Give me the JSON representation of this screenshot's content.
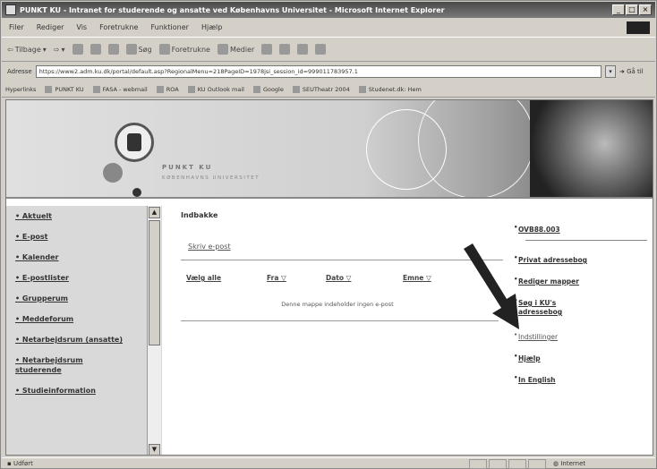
{
  "window": {
    "title": "PUNKT KU - Intranet for studerende og ansatte ved Københavns Universitet - Microsoft Internet Explorer",
    "controls": [
      "_",
      "□",
      "×"
    ]
  },
  "menubar": [
    "Filer",
    "Rediger",
    "Vis",
    "Foretrukne",
    "Funktioner",
    "Hjælp"
  ],
  "toolbar": {
    "back": "Tilbage",
    "search": "Søg",
    "favorites": "Foretrukne",
    "media": "Medier"
  },
  "address": {
    "label": "Adresse",
    "url": "https://www2.adm.ku.dk/portal/default.asp?RegionalMenu=218PageID=1978jsi_session_id=999011783957.1",
    "go": "Gå til"
  },
  "links": {
    "label": "Hyperlinks",
    "items": [
      "PUNKT KU",
      "FASA - webmail",
      "ROA",
      "KU Outlook mail",
      "Google",
      "SEUTheatr 2004",
      "Studenet.dk: Hem"
    ]
  },
  "banner": {
    "brand": "PUNKT KU",
    "sub": "KØBENHAVNS UNIVERSITET"
  },
  "nav": {
    "items": [
      "Aktuelt",
      "E-post",
      "Kalender",
      "E-postlister",
      "Grupperum",
      "Meddeforum",
      "Netarbejdsrum (ansatte)",
      "Netarbejdsrum studerende",
      "Studieinformation"
    ]
  },
  "inbox": {
    "title": "Indbakke",
    "write_link": "Skriv e-post",
    "columns": [
      "Vælg alle",
      "Fra ▽",
      "Dato ▽",
      "Emne ▽"
    ],
    "empty_message": "Denne mappe indeholder ingen e-post"
  },
  "sidebar_right": {
    "items": [
      "OVB88.003",
      "Privat adressebog",
      "Rediger mapper",
      "Søg i KU's adressebog",
      "Indstillinger",
      "Hjælp",
      "In English"
    ]
  },
  "status": {
    "left": "Udført",
    "zone": "Internet"
  }
}
